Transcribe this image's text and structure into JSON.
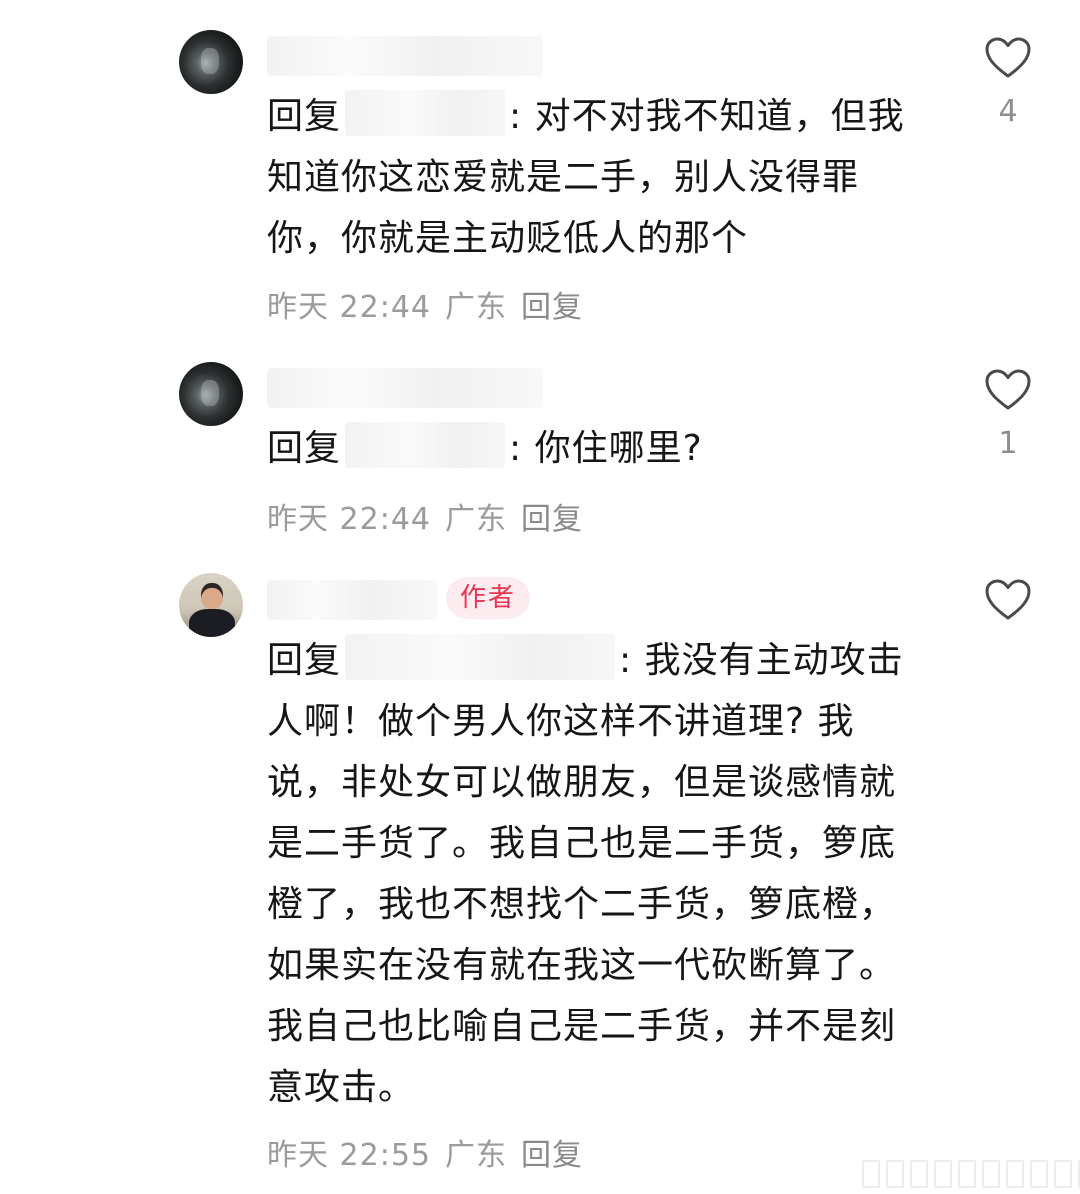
{
  "comments": [
    {
      "avatar": "dark-tunnel-avatar",
      "reply_prefix": "回复",
      "text": ": 对不对我不知道，但我知道你这恋爱就是二手，别人没得罪你，你就是主动贬低人的那个",
      "time": "昨天 22:44",
      "location": "广东",
      "reply_label": "回复",
      "likes": "4"
    },
    {
      "avatar": "dark-tunnel-avatar",
      "reply_prefix": "回复",
      "text": ": 你住哪里?",
      "time": "昨天 22:44",
      "location": "广东",
      "reply_label": "回复",
      "likes": "1"
    },
    {
      "avatar": "author-photo-avatar",
      "badge": "作者",
      "reply_prefix": "回复",
      "text": ": 我没有主动攻击人啊！做个男人你这样不讲道理? 我说，非处女可以做朋友，但是谈感情就是二手货了。我自己也是二手货，箩底橙了，我也不想找个二手货，箩底橙，如果实在没有就在我这一代砍断算了。我自己也比喻自己是二手货，并不是刻意攻击。",
      "time": "昨天 22:55",
      "location": "广东",
      "reply_label": "回复",
      "likes": ""
    }
  ],
  "colors": {
    "text": "#161616",
    "meta": "#9b9b9b",
    "badge_bg": "#fdecef",
    "badge_text": "#e8344f"
  },
  "icons": [
    "heart-outline-icon"
  ]
}
